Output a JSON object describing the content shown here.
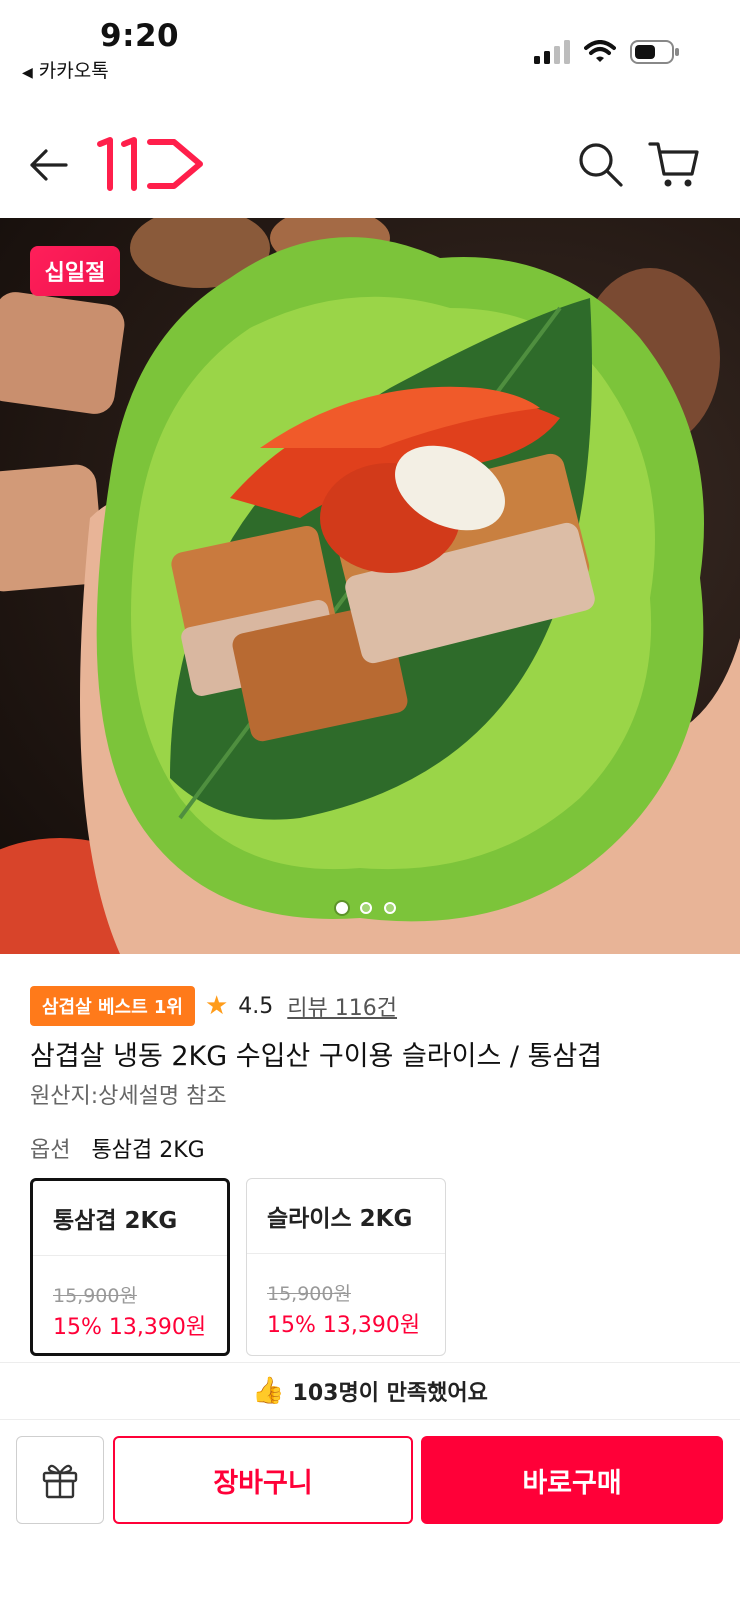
{
  "status_bar": {
    "time": "9:20",
    "back_app": "카카오톡"
  },
  "header": {
    "logo_text": "11"
  },
  "product_image": {
    "event_badge": "십일절",
    "slide_count": 3,
    "active_slide": 1
  },
  "product": {
    "best_badge": "삼겹살 베스트 1위",
    "rating": "4.5",
    "review_link": "리뷰 116건",
    "title": "삼겹살 냉동 2KG 수입산 구이용 슬라이스 / 통삼겹",
    "origin": "원산지:상세설명 참조"
  },
  "option": {
    "label": "옵션",
    "selected_value": "통삼겹 2KG",
    "cards": [
      {
        "name": "통삼겹 2KG",
        "original_price": "15,900원",
        "sale_price": "15% 13,390원",
        "selected": true
      },
      {
        "name": "슬라이스 2KG",
        "original_price": "15,900원",
        "sale_price": "15% 13,390원",
        "selected": false
      }
    ]
  },
  "satisfaction": {
    "emoji": "👍",
    "text": "103명이 만족했어요"
  },
  "bottom_bar": {
    "cart_label": "장바구니",
    "buy_label": "바로구매"
  },
  "colors": {
    "brand_red": "#ff0038",
    "badge_orange": "#ff7a1a",
    "star": "#ff9c1a"
  }
}
